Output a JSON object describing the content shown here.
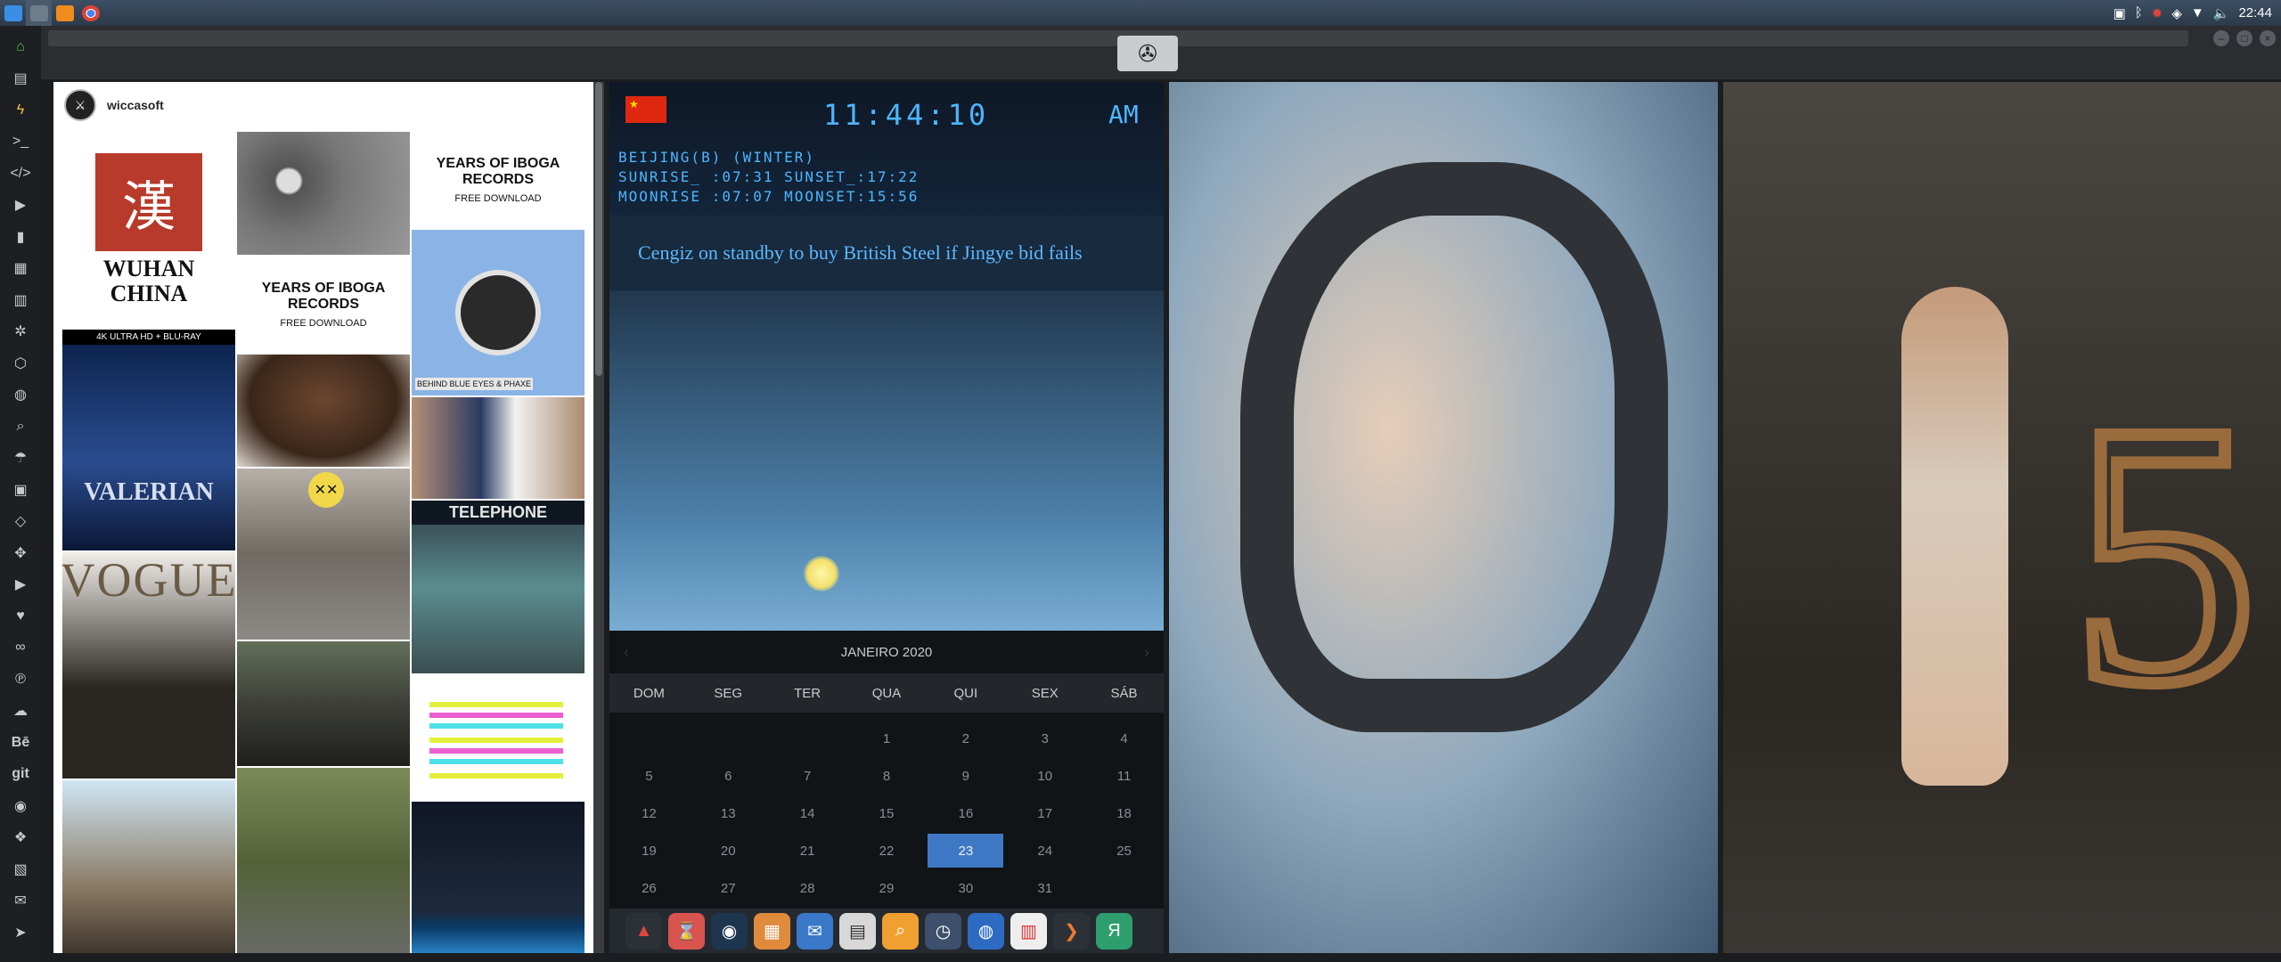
{
  "clock": {
    "time": "22:44"
  },
  "instagram": {
    "username": "wiccasoft"
  },
  "weather": {
    "time": "11:44:10",
    "ampm": "AM",
    "flag_label": "",
    "location": "BEIJING(B) (WINTER)",
    "sun": "SUNRISE_ :07:31 SUNSET_:17:22",
    "moon": "MOONRISE :07:07 MOONSET:15:56",
    "headline": "Cengiz on standby to buy British Steel if Jingye bid fails"
  },
  "calendar": {
    "month": "JANEIRO 2020",
    "weekdays": [
      "DOM",
      "SEG",
      "TER",
      "QUA",
      "QUI",
      "SEX",
      "SÁB"
    ],
    "cells": [
      "",
      "",
      "",
      "1",
      "2",
      "3",
      "4",
      "5",
      "6",
      "7",
      "8",
      "9",
      "10",
      "11",
      "12",
      "13",
      "14",
      "15",
      "16",
      "17",
      "18",
      "19",
      "20",
      "21",
      "22",
      "23",
      "24",
      "25",
      "26",
      "27",
      "28",
      "29",
      "30",
      "31",
      ""
    ],
    "today": "23"
  },
  "tiles": {
    "wuhan": "WUHAN CHINA",
    "iboga1": "YEARS OF IBOGA RECORDS",
    "iboga2": "YEARS OF IBOGA RECORDS",
    "iboga_sub": "FREE DOWNLOAD",
    "valerian": "VALERIAN",
    "fourk": "4K ULTRA HD + BLU-RAY",
    "vogue": "VOGUE",
    "telephone": "TELEPHONE",
    "behind": "BEHIND BLUE EYES & PHAXE"
  },
  "colors": {
    "accent": "#4db6ff",
    "today": "#3f78c4",
    "sidebar_active": "#5cc15c"
  }
}
